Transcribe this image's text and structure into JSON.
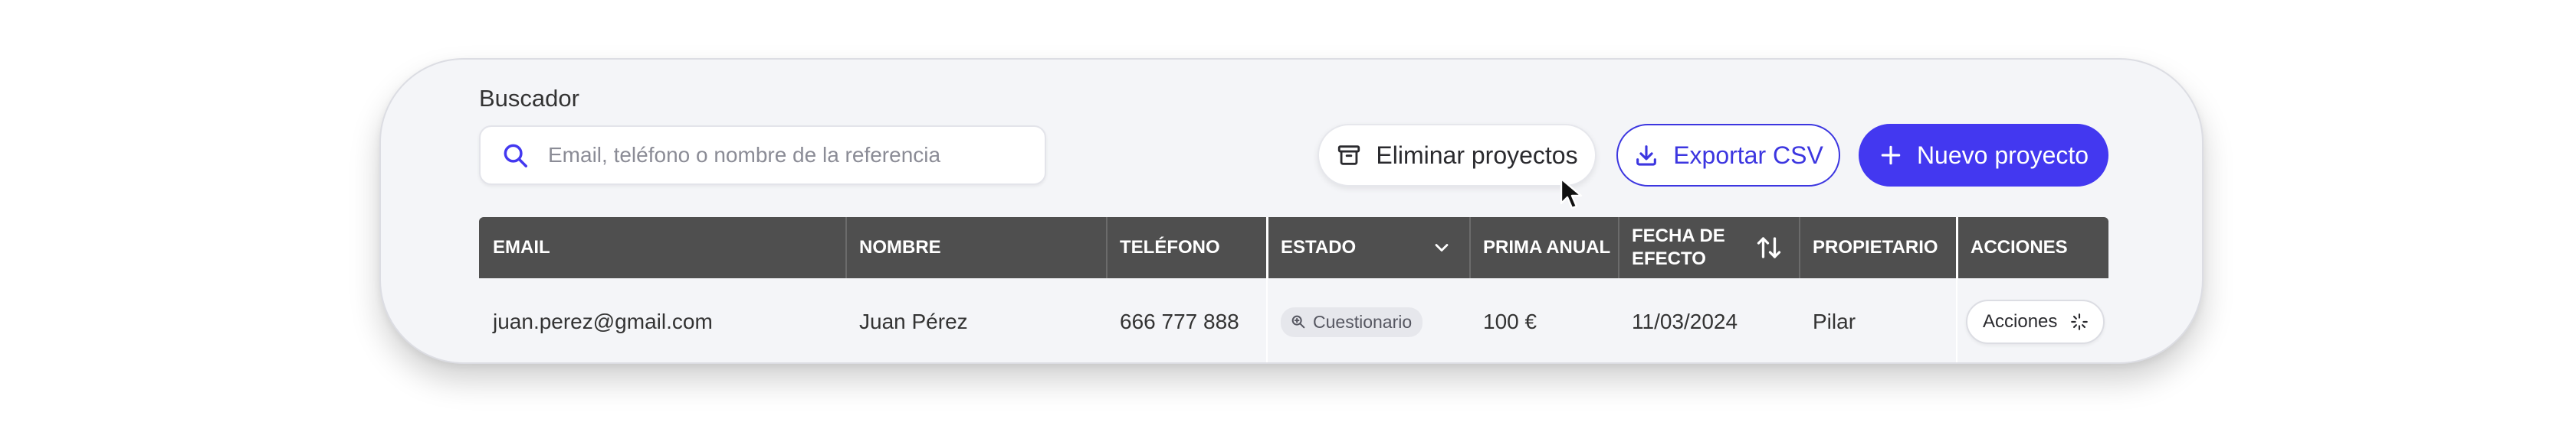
{
  "search": {
    "label": "Buscador",
    "placeholder": "Email, teléfono o nombre de la referencia"
  },
  "toolbar": {
    "delete_label": "Eliminar proyectos",
    "export_label": "Exportar CSV",
    "new_label": "Nuevo proyecto"
  },
  "table": {
    "headers": {
      "email": "EMAIL",
      "name": "NOMBRE",
      "phone": "TELÉFONO",
      "status": "ESTADO",
      "premium": "PRIMA ANUAL",
      "date": "FECHA DE EFECTO",
      "owner": "PROPIETARIO",
      "actions": "ACCIONES"
    },
    "rows": [
      {
        "email": "juan.perez@gmail.com",
        "name": "Juan Pérez",
        "phone": "666 777 888",
        "status": "Cuestionario",
        "premium": "100 €",
        "date": "11/03/2024",
        "owner": "Pilar",
        "actions_label": "Acciones"
      }
    ]
  },
  "icons": {
    "search": "search-icon",
    "delete": "archive-icon",
    "export": "download-icon",
    "new": "plus-icon",
    "status_dropdown": "chevron-down-icon",
    "sort": "sort-arrows-icon",
    "status": "search-zoom-icon",
    "actions": "sparkle-loader-icon"
  },
  "colors": {
    "accent": "#4338f0",
    "header_bg": "#4f4f4f",
    "card_bg": "#f4f5f8"
  }
}
